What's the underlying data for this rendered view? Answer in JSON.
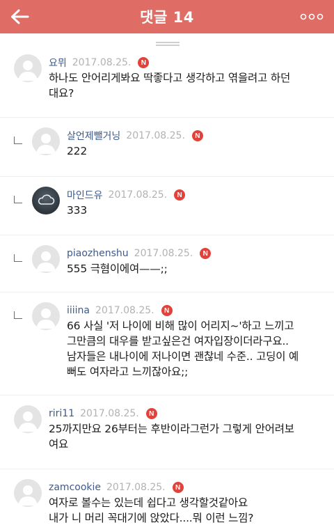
{
  "header": {
    "title": "댓글 14",
    "bg_color": "#df6c65"
  },
  "badge_label": "N",
  "comments": [
    {
      "author": "요뮈",
      "date": "2017.08.25.",
      "text": "하나도 안어리게봐요 딱좋다고 생각하고 엮을려고 하던\n대요?",
      "reply": false,
      "avatar": "default"
    },
    {
      "author": "살언제뺄거닝",
      "date": "2017.08.25.",
      "text": "222",
      "reply": true,
      "avatar": "default"
    },
    {
      "author": "마인드유",
      "date": "2017.08.25.",
      "text": "333",
      "reply": true,
      "avatar": "cloud-icon"
    },
    {
      "author": "piaozhenshu",
      "date": "2017.08.25.",
      "text": "555 극혐이에여——;;",
      "reply": true,
      "avatar": "default"
    },
    {
      "author": "iiiina",
      "date": "2017.08.25.",
      "text": "66 사실 '저 나이에 비해 많이 어리지~'하고 느끼고\n그만큼의 대우를 받고싶은건 여자입장이더라구요..\n남자들은 내나이에 저나이면 괜찮네 수준.. 고딩이 예\n뻐도 여자라고 느끼잖아요;;",
      "reply": true,
      "avatar": "default"
    },
    {
      "author": "riri11",
      "date": "2017.08.25.",
      "text": "25까지만요 26부터는 후반이라그런가 그렇게 안어려보\n여요",
      "reply": false,
      "avatar": "default"
    },
    {
      "author": "zamcookie",
      "date": "2017.08.25.",
      "text": "여자로 볼수는 있는데 쉽다고 생각할것같아요\n내가 니 머리 꼭대기에 앉았다....뭐 이런 느낌?",
      "reply": false,
      "avatar": "default"
    }
  ]
}
